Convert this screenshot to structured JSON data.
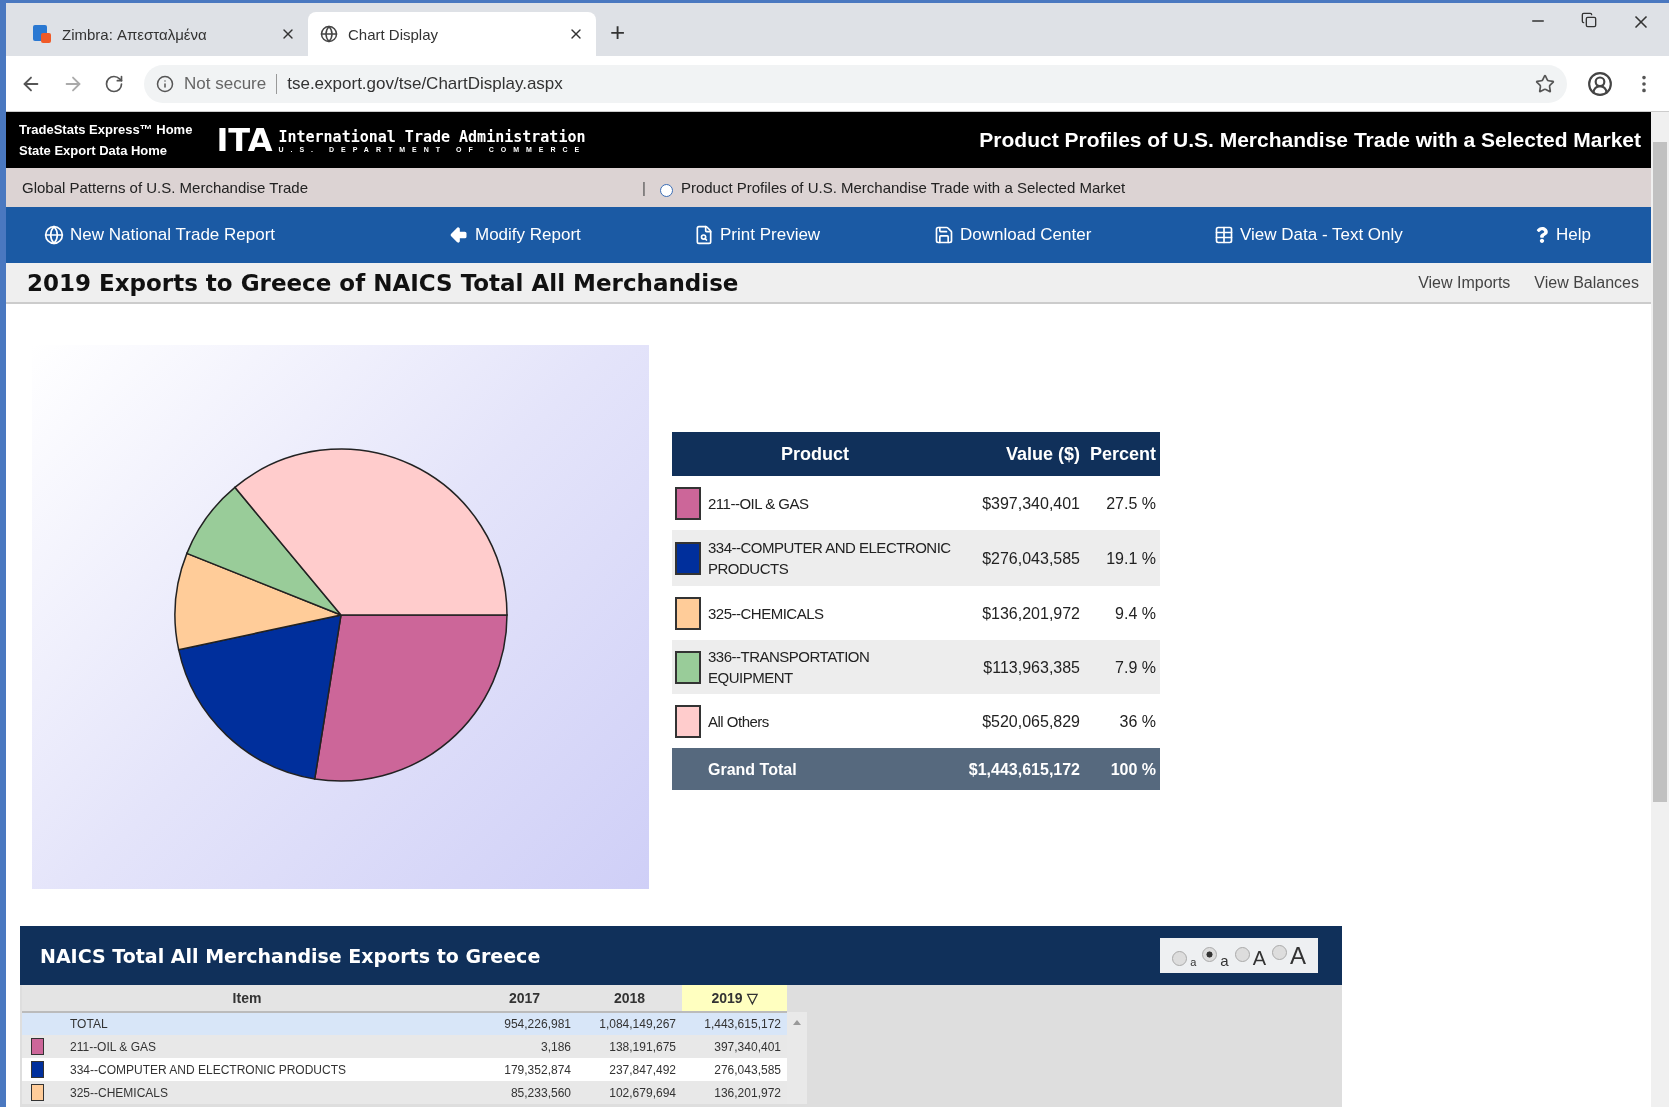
{
  "browser": {
    "tabs": [
      {
        "title": "Zimbra: Απεσταλμένα",
        "selected": false
      },
      {
        "title": "Chart Display",
        "selected": true
      }
    ],
    "new_tab": "+",
    "security": "Not secure",
    "url": "tse.export.gov/tse/ChartDisplay.aspx"
  },
  "header": {
    "links": [
      "TradeStats Express™ Home",
      "State Export Data Home"
    ],
    "logo": "ITA",
    "agency": "International Trade Administration",
    "department": "U.S. DEPARTMENT OF COMMERCE",
    "title": "Product Profiles of U.S. Merchandise Trade with a Selected Market"
  },
  "mode_bar": {
    "current": "Global Patterns of U.S. Merchandise Trade",
    "separator": "|",
    "option": {
      "label": "Product Profiles of U.S. Merchandise Trade with a Selected Market",
      "selected": false
    }
  },
  "toolbar": [
    {
      "label": "New National Trade Report",
      "kind": "new"
    },
    {
      "label": "Modify Report",
      "kind": "back"
    },
    {
      "label": "Print Preview",
      "kind": "print"
    },
    {
      "label": "Download Center",
      "kind": "download"
    },
    {
      "label": "View Data - Text Only",
      "kind": "table"
    },
    {
      "label": "Help",
      "kind": "help"
    }
  ],
  "report": {
    "title": "2019 Exports to Greece of NAICS Total All Merchandise",
    "links": [
      "View Imports",
      "View Balances"
    ]
  },
  "chart": {
    "chart_data": {
      "type": "pie",
      "values": [
        27.5,
        19.1,
        9.4,
        7.9,
        36
      ]
    }
  },
  "legend": {
    "columns": [
      "Product",
      "Value ($)",
      "Percent"
    ],
    "rows": [
      {
        "product": "211--OIL & GAS",
        "value": "$397,340,401",
        "percent": "27.5 %",
        "color": "#cc6699"
      },
      {
        "product": "334--COMPUTER AND ELECTRONIC PRODUCTS",
        "value": "$276,043,585",
        "percent": "19.1 %",
        "color": "#002f9c"
      },
      {
        "product": "325--CHEMICALS",
        "value": "$136,201,972",
        "percent": "9.4 %",
        "color": "#ffcc99"
      },
      {
        "product": "336--TRANSPORTATION EQUIPMENT",
        "value": "$113,963,385",
        "percent": "7.9 %",
        "color": "#99cc99"
      },
      {
        "product": "All Others",
        "value": "$520,065,829",
        "percent": "36 %",
        "color": "#ffcccc"
      }
    ],
    "total": {
      "label": "Grand Total",
      "value": "$1,443,615,172",
      "percent": "100 %"
    }
  },
  "data_panel": {
    "title": "NAICS Total All Merchandise Exports to Greece",
    "font_sizes": [
      {
        "label": "a",
        "selected": false
      },
      {
        "label": "a",
        "selected": true
      },
      {
        "label": "A",
        "selected": false
      },
      {
        "label": "A",
        "selected": false
      }
    ],
    "columns": [
      {
        "label": "Item",
        "selected": false
      },
      {
        "label": "2017",
        "selected": false
      },
      {
        "label": "2018",
        "selected": false
      },
      {
        "label": "2019",
        "selected": true
      }
    ],
    "sort_mark": "▽",
    "rows": [
      {
        "kind": "total",
        "item": "TOTAL",
        "values": [
          "954,226,981",
          "1,084,149,267",
          "1,443,615,172"
        ]
      },
      {
        "kind": "product",
        "item": "211--OIL & GAS",
        "color": "#cc6699",
        "values": [
          "3,186",
          "138,191,675",
          "397,340,401"
        ]
      },
      {
        "kind": "product",
        "item": "334--COMPUTER AND ELECTRONIC PRODUCTS",
        "color": "#002f9c",
        "values": [
          "179,352,874",
          "237,847,492",
          "276,043,585"
        ]
      },
      {
        "kind": "product",
        "item": "325--CHEMICALS",
        "color": "#ffcc99",
        "values": [
          "85,233,560",
          "102,679,694",
          "136,201,972"
        ]
      }
    ]
  }
}
